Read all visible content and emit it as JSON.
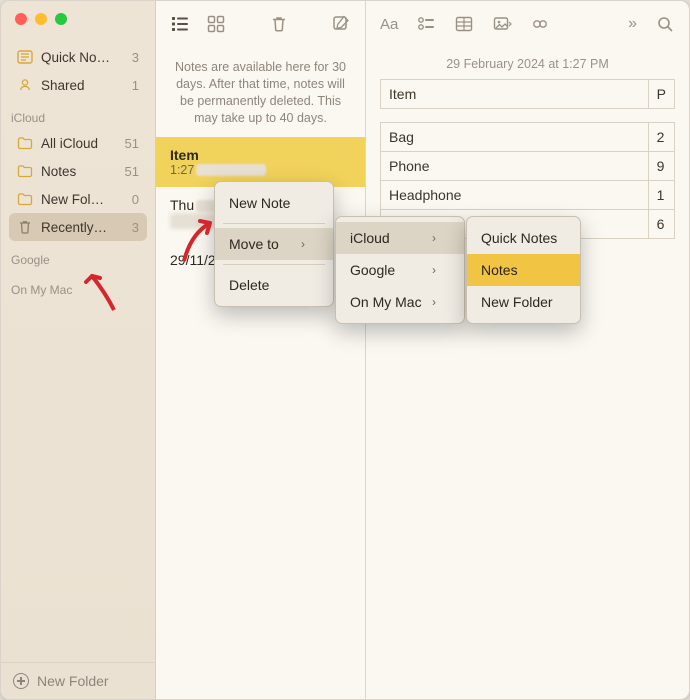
{
  "sidebar": {
    "quick": {
      "label": "Quick No…",
      "count": "3"
    },
    "shared": {
      "label": "Shared",
      "count": "1"
    },
    "sections": {
      "icloud": {
        "head": "iCloud",
        "items": [
          {
            "label": "All iCloud",
            "count": "51"
          },
          {
            "label": "Notes",
            "count": "51"
          },
          {
            "label": "New Fol…",
            "count": "0"
          },
          {
            "label": "Recently…",
            "count": "3"
          }
        ]
      },
      "google": {
        "head": "Google"
      },
      "onmymac": {
        "head": "On My Mac"
      }
    },
    "bottom": {
      "label": "New Folder"
    }
  },
  "middle": {
    "info": "Notes are available here for 30 days. After that time, notes will be permanently deleted. This may take up to 40 days.",
    "items": [
      {
        "title": "Item",
        "sub": "1:27"
      },
      {
        "title": "Thu",
        "sub": ""
      },
      {
        "title": "29/11/23",
        "sub": ""
      }
    ]
  },
  "editor": {
    "date": "29 February 2024 at 1:27 PM",
    "table": {
      "head": [
        "Item",
        "P"
      ],
      "rows": [
        [
          "Bag",
          "2"
        ],
        [
          "Phone",
          "9"
        ],
        [
          "Headphone",
          "1"
        ],
        [
          "",
          "6"
        ]
      ]
    }
  },
  "context": {
    "new_note": "New Note",
    "move_to": "Move to",
    "delete": "Delete"
  },
  "sub1": {
    "icloud": "iCloud",
    "google": "Google",
    "onmymac": "On My Mac"
  },
  "sub2": {
    "quick": "Quick Notes",
    "notes": "Notes",
    "newfolder": "New Folder"
  }
}
